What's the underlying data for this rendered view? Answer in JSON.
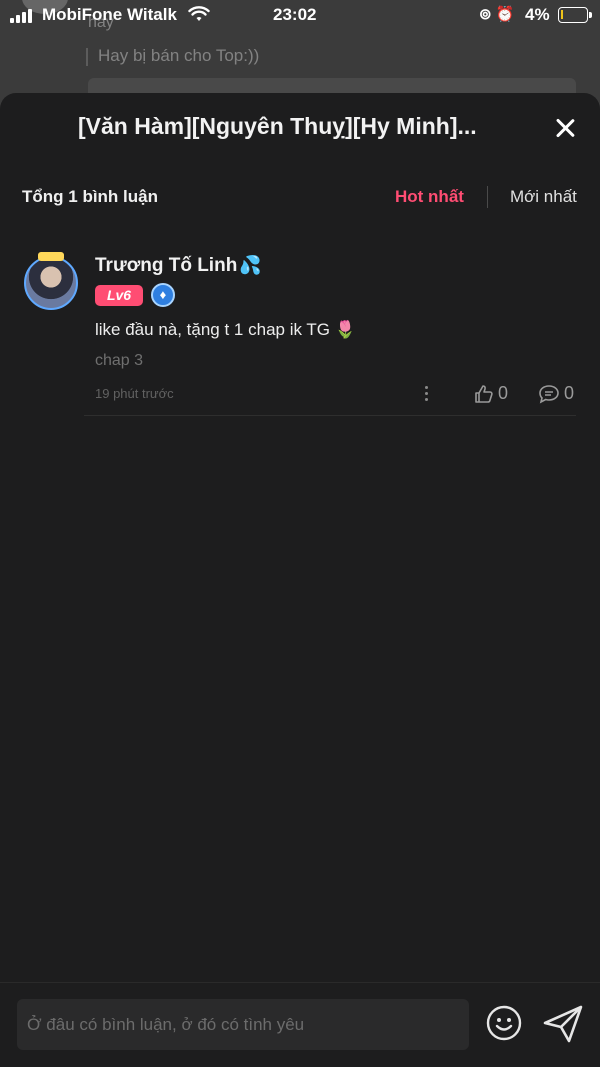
{
  "status_bar": {
    "carrier": "MobiFone Witalk",
    "time": "23:02",
    "battery": "4%",
    "battery_level": 0.04,
    "icons": [
      "signal-icon",
      "wifi-icon",
      "orientation-lock-icon",
      "alarm-icon",
      "battery-icon"
    ]
  },
  "background": {
    "name": "hay",
    "line": "Hay bị bán cho Top:))"
  },
  "sheet": {
    "title": "[Văn Hàm][Nguyên Thuỵ][Hy Minh]...",
    "close_icon": "close-icon"
  },
  "comments_header": {
    "count_label": "Tổng 1 bình luận",
    "sort_hot": "Hot nhất",
    "sort_new": "Mới nhất",
    "active_color": "#ff4d73"
  },
  "comments": [
    {
      "username": "Trương Tố Linh",
      "name_emoji": "💦",
      "level": "Lv6",
      "text": "like đầu nà, tặng t 1 chap ik TG",
      "text_emoji": "🌷",
      "chapter": "chap 3",
      "time": "19 phút trước",
      "likes": "0",
      "replies": "0"
    }
  ],
  "composer": {
    "placeholder": "Ở đâu có bình luận, ở đó có tình yêu",
    "emoji_icon": "smiley-icon",
    "send_icon": "send-icon"
  }
}
